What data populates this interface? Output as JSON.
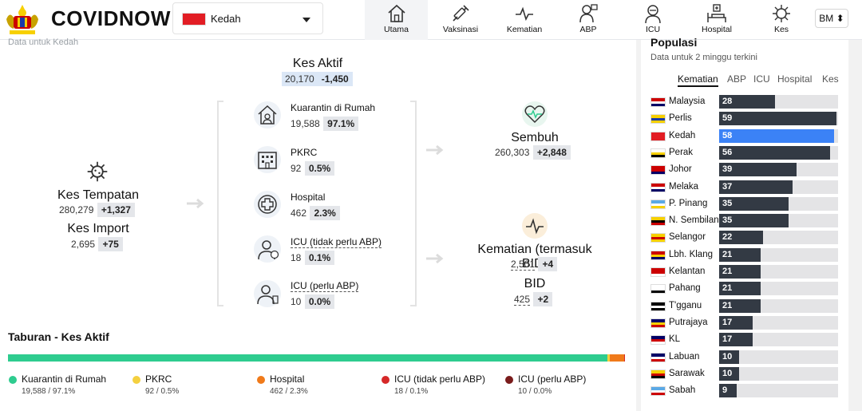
{
  "header": {
    "brand": "COVIDNOW",
    "state": "Kedah",
    "nav": [
      {
        "label": "Utama",
        "icon": "home-icon"
      },
      {
        "label": "Vaksinasi",
        "icon": "syringe-icon"
      },
      {
        "label": "Kematian",
        "icon": "pulse-icon"
      },
      {
        "label": "ABP",
        "icon": "ventilator-icon"
      },
      {
        "label": "ICU",
        "icon": "icu-icon"
      },
      {
        "label": "Hospital",
        "icon": "hospital-bed-icon"
      },
      {
        "label": "Kes",
        "icon": "virus-icon"
      }
    ],
    "lang": "BM ⬍"
  },
  "left": {
    "subtitle": "Data untuk Kedah",
    "kes_aktif": {
      "label": "Kes Aktif",
      "value": "20,170",
      "delta": "-1,450"
    },
    "kes_tempatan": {
      "label": "Kes Tempatan",
      "value": "280,279",
      "delta": "+1,327"
    },
    "kes_import": {
      "label": "Kes Import",
      "value": "2,695",
      "delta": "+75"
    },
    "items": [
      {
        "label": "Kuarantin di Rumah",
        "value": "19,588",
        "pct": "97.1%"
      },
      {
        "label": "PKRC",
        "value": "92",
        "pct": "0.5%"
      },
      {
        "label": "Hospital",
        "value": "462",
        "pct": "2.3%"
      },
      {
        "label": "ICU (tidak perlu ABP)",
        "value": "18",
        "pct": "0.1%"
      },
      {
        "label": "ICU (perlu ABP)",
        "value": "10",
        "pct": "0.0%"
      }
    ],
    "sembuh": {
      "label": "Sembuh",
      "value": "260,303",
      "delta": "+2,848"
    },
    "kematian": {
      "label": "Kematian (termasuk BID)",
      "value": "2,501",
      "delta": "+4"
    },
    "bid": {
      "label": "BID",
      "value": "425",
      "delta": "+2"
    }
  },
  "distribution": {
    "title": "Taburan - Kes Aktif",
    "legend": [
      {
        "name": "Kuarantin di Rumah",
        "value": "19,588 / 97.1%",
        "fraction": 0.971,
        "color": "#2ecc8f"
      },
      {
        "name": "PKRC",
        "value": "92 / 0.5%",
        "fraction": 0.005,
        "color": "#f4d03f"
      },
      {
        "name": "Hospital",
        "value": "462 / 2.3%",
        "fraction": 0.023,
        "color": "#f07a1a"
      },
      {
        "name": "ICU (tidak perlu ABP)",
        "value": "18 / 0.1%",
        "fraction": 0.001,
        "color": "#d62828"
      },
      {
        "name": "ICU (perlu ABP)",
        "value": "10 / 0.0%",
        "fraction": 0.0,
        "color": "#7a1c1c"
      }
    ]
  },
  "right": {
    "title": "Populasi",
    "subtitle": "Data untuk 2 minggu terkini",
    "tabs": [
      "Kematian",
      "ABP",
      "ICU",
      "Hospital",
      "Kes"
    ],
    "max": 60,
    "states": [
      {
        "name": "Malaysia",
        "value": 28
      },
      {
        "name": "Perlis",
        "value": 59
      },
      {
        "name": "Kedah",
        "value": 58,
        "selected": true
      },
      {
        "name": "Perak",
        "value": 56
      },
      {
        "name": "Johor",
        "value": 39
      },
      {
        "name": "Melaka",
        "value": 37
      },
      {
        "name": "P. Pinang",
        "value": 35
      },
      {
        "name": "N. Sembilan",
        "value": 35
      },
      {
        "name": "Selangor",
        "value": 22
      },
      {
        "name": "Lbh. Klang",
        "value": 21
      },
      {
        "name": "Kelantan",
        "value": 21
      },
      {
        "name": "Pahang",
        "value": 21
      },
      {
        "name": "T'gganu",
        "value": 21
      },
      {
        "name": "Putrajaya",
        "value": 17
      },
      {
        "name": "KL",
        "value": 17
      },
      {
        "name": "Labuan",
        "value": 10
      },
      {
        "name": "Sarawak",
        "value": 10
      },
      {
        "name": "Sabah",
        "value": 9
      }
    ],
    "flag_colors": {
      "Malaysia": [
        "#cc0001",
        "#ffffff",
        "#010066"
      ],
      "Perlis": [
        "#f7d000",
        "#1a3aa8",
        "#f7d000"
      ],
      "Kedah": [
        "#e21d24",
        "#e21d24",
        "#e21d24"
      ],
      "Perak": [
        "#ffffff",
        "#f7d000",
        "#000000"
      ],
      "Johor": [
        "#cc0001",
        "#cc0001",
        "#010066"
      ],
      "Melaka": [
        "#cc0001",
        "#ffffff",
        "#010066"
      ],
      "P. Pinang": [
        "#5aa9e6",
        "#ffffff",
        "#f7d000"
      ],
      "N. Sembilan": [
        "#f7d000",
        "#000000",
        "#cc0001"
      ],
      "Selangor": [
        "#f7d000",
        "#cc0001",
        "#f7d000"
      ],
      "Lbh. Klang": [
        "#cc0001",
        "#f7d000",
        "#010066"
      ],
      "Kelantan": [
        "#cc0001",
        "#cc0001",
        "#ffffff"
      ],
      "Pahang": [
        "#ffffff",
        "#ffffff",
        "#000000"
      ],
      "T'gganu": [
        "#000000",
        "#ffffff",
        "#000000"
      ],
      "Putrajaya": [
        "#010066",
        "#f7d000",
        "#cc0001"
      ],
      "KL": [
        "#010066",
        "#cc0001",
        "#ffffff"
      ],
      "Labuan": [
        "#010066",
        "#ffffff",
        "#cc0001"
      ],
      "Sarawak": [
        "#f7d000",
        "#cc0001",
        "#000000"
      ],
      "Sabah": [
        "#5aa9e6",
        "#ffffff",
        "#cc0001"
      ]
    }
  }
}
